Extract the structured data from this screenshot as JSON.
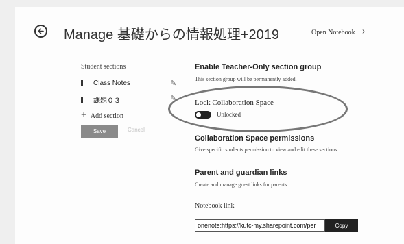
{
  "header": {
    "title": "Manage 基礎からの情報処理+2019",
    "open_notebook": "Open Notebook"
  },
  "sections": {
    "heading": "Student sections",
    "items": [
      {
        "label": "Class Notes"
      },
      {
        "label": "課題０３"
      }
    ],
    "add_label": "Add section",
    "save_label": "Save",
    "cancel_label": "Cancel"
  },
  "teacher_only": {
    "heading": "Enable Teacher-Only section group",
    "note": "This section group will be permanently added."
  },
  "lock": {
    "title": "Lock Collaboration Space",
    "state": "Unlocked"
  },
  "permissions": {
    "heading": "Collaboration Space permissions",
    "desc": "Give specific students permission to view and edit these sections"
  },
  "guardians": {
    "heading": "Parent and guardian links",
    "desc": "Create and manage guest links for parents"
  },
  "notebook_link": {
    "title": "Notebook link",
    "url": "onenote:https://kutc-my.sharepoint.com/per",
    "copy_label": "Copy"
  },
  "colors": {
    "page_bg": "#efefef",
    "panel_bg": "#fdfdfd",
    "save_bg": "#8a8a8a",
    "copy_bg": "#222222",
    "annotation_ellipse": "#777777"
  }
}
